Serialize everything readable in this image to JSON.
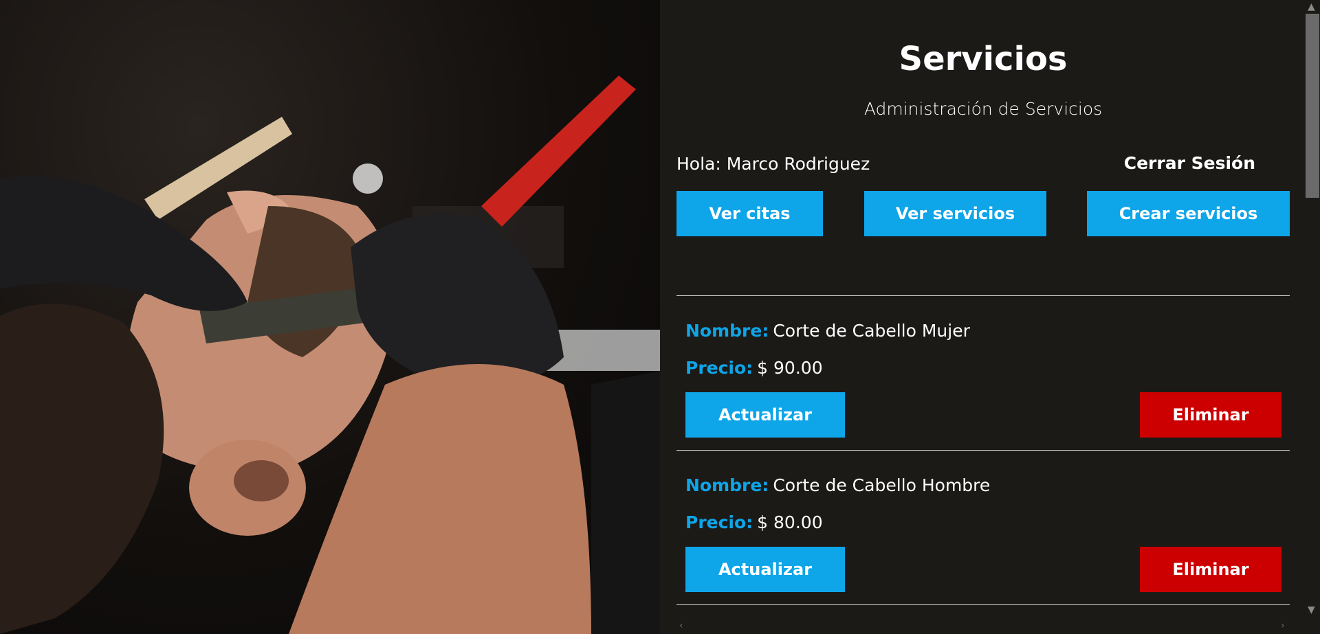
{
  "hero": {
    "image": "barber-shaving-beard-photo"
  },
  "header": {
    "title": "Servicios",
    "subtitle": "Administración de Servicios"
  },
  "user": {
    "greeting": "Hola: Marco Rodriguez",
    "logout_label": "Cerrar Sesión"
  },
  "nav": {
    "appointments_label": "Ver citas",
    "services_label": "Ver servicios",
    "create_label": "Crear servicios"
  },
  "labels": {
    "name": "Nombre:",
    "price": "Precio:",
    "update": "Actualizar",
    "delete": "Eliminar"
  },
  "services": [
    {
      "name": "Corte de Cabello Mujer",
      "price": "$ 90.00"
    },
    {
      "name": "Corte de Cabello Hombre",
      "price": "$ 80.00"
    }
  ],
  "colors": {
    "accent": "#0ea5e9",
    "danger": "#cc0000",
    "background": "#1b1a17"
  },
  "icons": {
    "scroll_up": "▲",
    "scroll_down": "▼",
    "scroll_left": "‹",
    "scroll_right": "›"
  }
}
